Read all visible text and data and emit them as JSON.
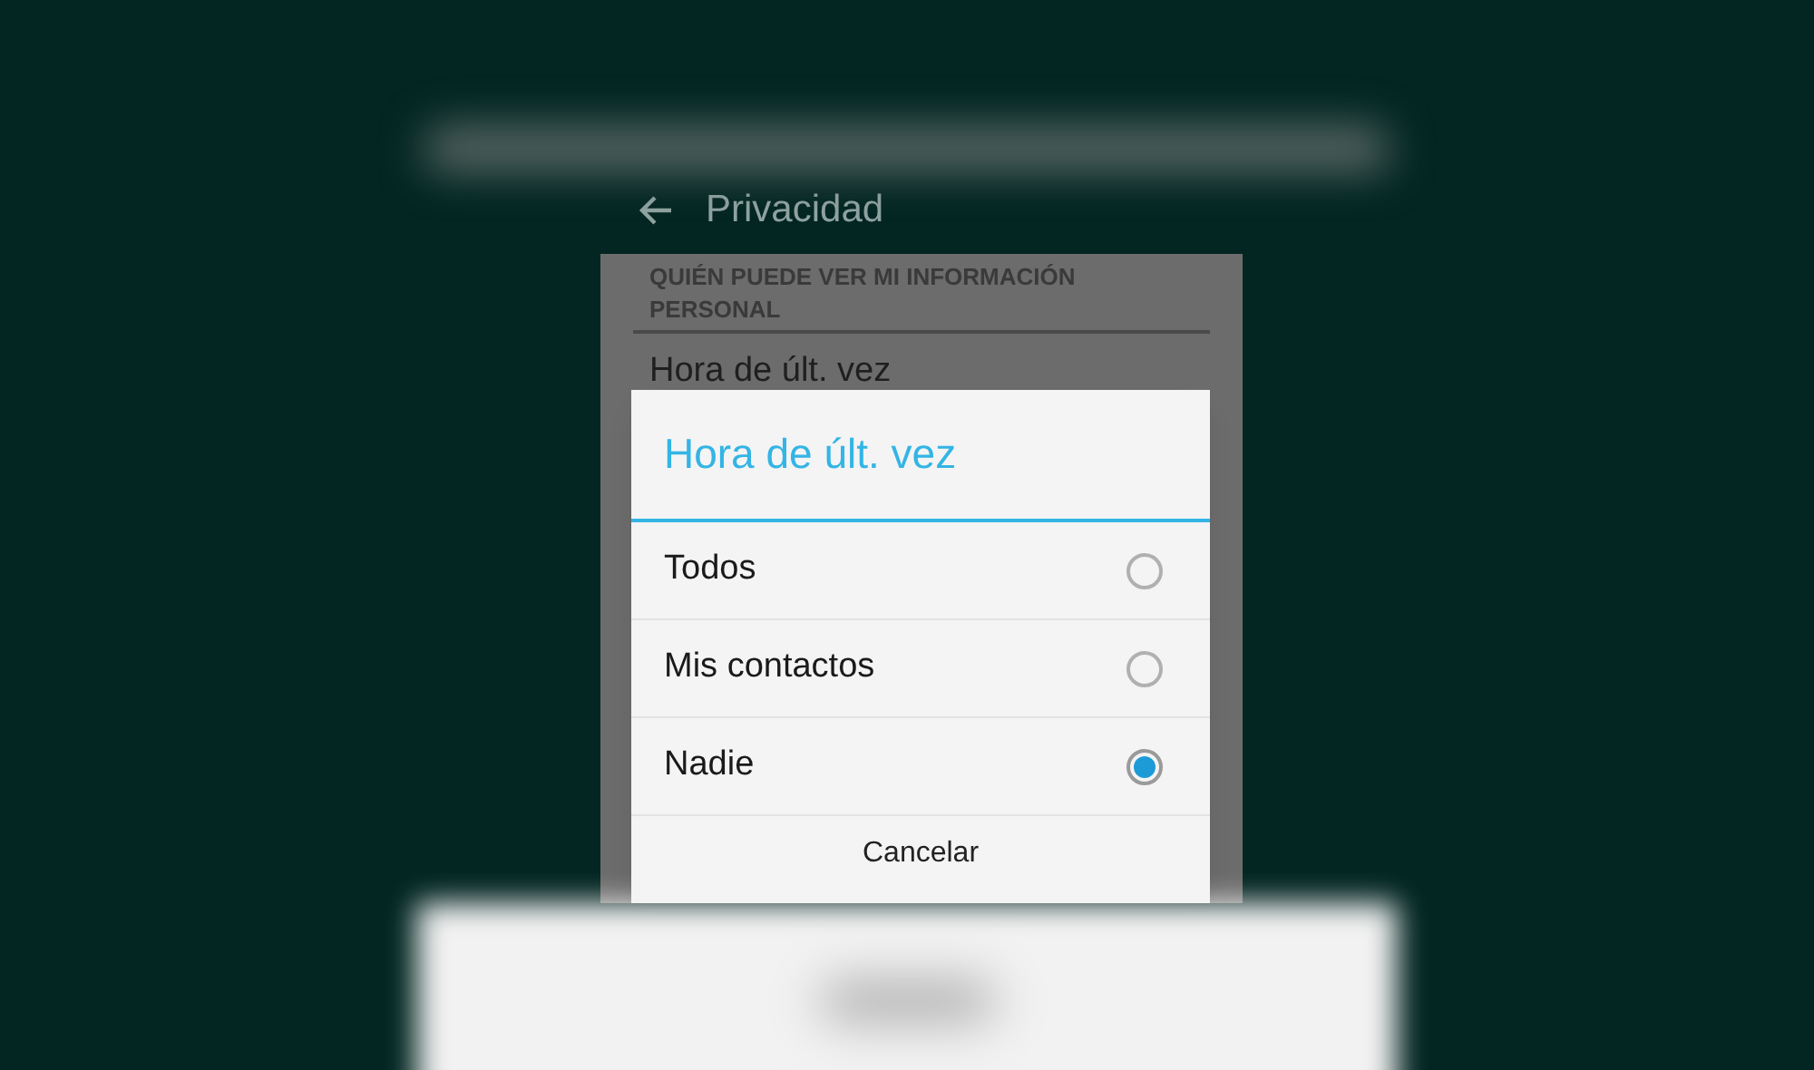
{
  "header": {
    "title": "Privacidad"
  },
  "section": {
    "heading": "QUIÉN PUEDE VER MI INFORMACIÓN PERSONAL",
    "items": [
      "Hora de últ. vez"
    ]
  },
  "dialog": {
    "title": "Hora de últ. vez",
    "options": [
      {
        "label": "Todos",
        "selected": false
      },
      {
        "label": "Mis contactos",
        "selected": false
      },
      {
        "label": "Nadie",
        "selected": true
      }
    ],
    "cancel": "Cancelar"
  }
}
